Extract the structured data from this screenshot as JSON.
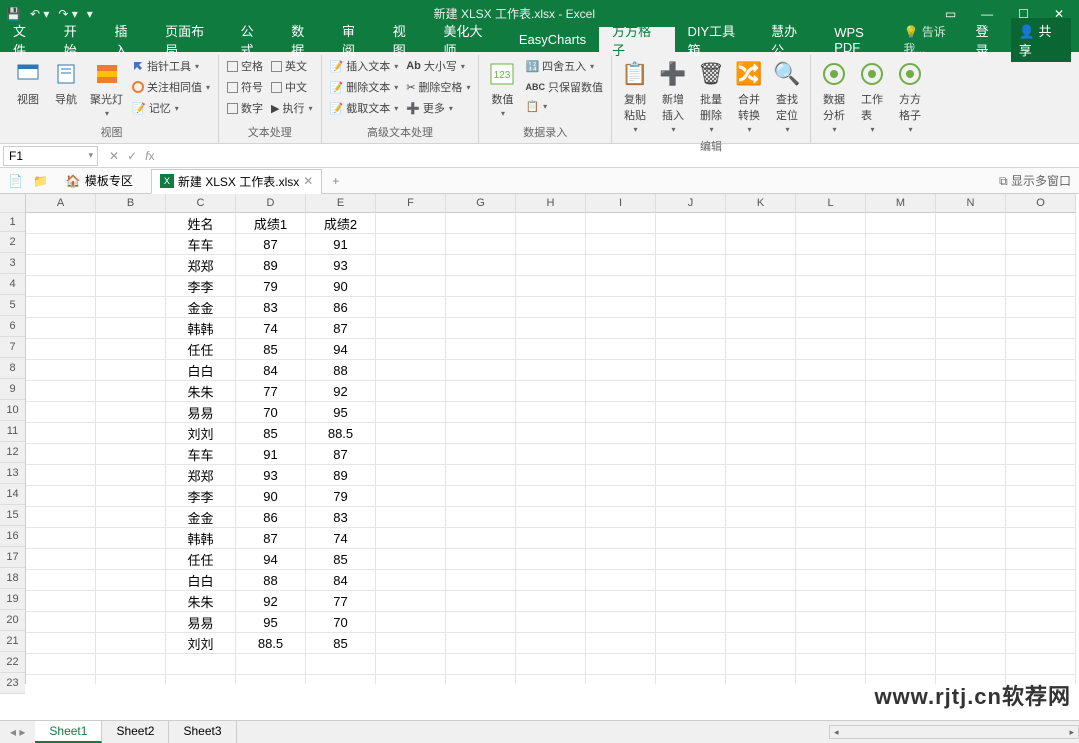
{
  "title": "新建 XLSX 工作表.xlsx - Excel",
  "menutabs": [
    "文件",
    "开始",
    "插入",
    "页面布局",
    "公式",
    "数据",
    "审阅",
    "视图",
    "美化大师",
    "EasyCharts",
    "方方格子",
    "DIY工具箱",
    "慧办公",
    "WPS PDF"
  ],
  "activeTab": 10,
  "tellme": "告诉我...",
  "login": "登录",
  "share": "共享",
  "ribbon": {
    "view": {
      "label": "视图",
      "btns": [
        "视图",
        "导航",
        "聚光灯"
      ]
    },
    "viewopts": {
      "items": [
        "指针工具",
        "关注相同值",
        "记忆"
      ]
    },
    "text": {
      "label": "文本处理",
      "l": [
        "空格",
        "符号",
        "数字"
      ],
      "r": [
        "英文",
        "中文",
        "执行"
      ]
    },
    "adv": {
      "label": "高级文本处理",
      "items": [
        "插入文本",
        "删除文本",
        "截取文本"
      ],
      "r": [
        "大小写",
        "删除空格",
        "更多"
      ]
    },
    "data": {
      "label": "数据录入",
      "big": "数值",
      "items": [
        "四舍五入",
        "只保留数值"
      ]
    },
    "edit": {
      "label": "编辑",
      "btns": [
        "复制粘贴",
        "新增插入",
        "批量删除",
        "合并转换",
        "查找定位"
      ]
    },
    "misc": {
      "btns": [
        "数据分析",
        "工作表",
        "方方格子"
      ]
    }
  },
  "namebox": "F1",
  "doctabs": {
    "template": "模板专区",
    "file": "新建 XLSX 工作表.xlsx",
    "multi": "显示多窗口"
  },
  "columns": [
    "A",
    "B",
    "C",
    "D",
    "E",
    "F",
    "G",
    "H",
    "I",
    "J",
    "K",
    "L",
    "M",
    "N",
    "O"
  ],
  "rows": [
    {
      "n": 1,
      "c": "姓名",
      "d": "成绩1",
      "e": "成绩2"
    },
    {
      "n": 2,
      "c": "车车",
      "d": "87",
      "e": "91"
    },
    {
      "n": 3,
      "c": "郑郑",
      "d": "89",
      "e": "93"
    },
    {
      "n": 4,
      "c": "李李",
      "d": "79",
      "e": "90"
    },
    {
      "n": 5,
      "c": "金金",
      "d": "83",
      "e": "86"
    },
    {
      "n": 6,
      "c": "韩韩",
      "d": "74",
      "e": "87"
    },
    {
      "n": 7,
      "c": "任任",
      "d": "85",
      "e": "94"
    },
    {
      "n": 8,
      "c": "白白",
      "d": "84",
      "e": "88"
    },
    {
      "n": 9,
      "c": "朱朱",
      "d": "77",
      "e": "92"
    },
    {
      "n": 10,
      "c": "易易",
      "d": "70",
      "e": "95"
    },
    {
      "n": 11,
      "c": "刘刘",
      "d": "85",
      "e": "88.5"
    },
    {
      "n": 12,
      "c": "车车",
      "d": "91",
      "e": "87"
    },
    {
      "n": 13,
      "c": "郑郑",
      "d": "93",
      "e": "89"
    },
    {
      "n": 14,
      "c": "李李",
      "d": "90",
      "e": "79"
    },
    {
      "n": 15,
      "c": "金金",
      "d": "86",
      "e": "83"
    },
    {
      "n": 16,
      "c": "韩韩",
      "d": "87",
      "e": "74"
    },
    {
      "n": 17,
      "c": "任任",
      "d": "94",
      "e": "85"
    },
    {
      "n": 18,
      "c": "白白",
      "d": "88",
      "e": "84"
    },
    {
      "n": 19,
      "c": "朱朱",
      "d": "92",
      "e": "77"
    },
    {
      "n": 20,
      "c": "易易",
      "d": "95",
      "e": "70"
    },
    {
      "n": 21,
      "c": "刘刘",
      "d": "88.5",
      "e": "85"
    },
    {
      "n": 22,
      "c": "",
      "d": "",
      "e": ""
    },
    {
      "n": 23,
      "c": "",
      "d": "",
      "e": ""
    }
  ],
  "sheets": [
    "Sheet1",
    "Sheet2",
    "Sheet3"
  ],
  "watermark": "www.rjtj.cn软荐网"
}
